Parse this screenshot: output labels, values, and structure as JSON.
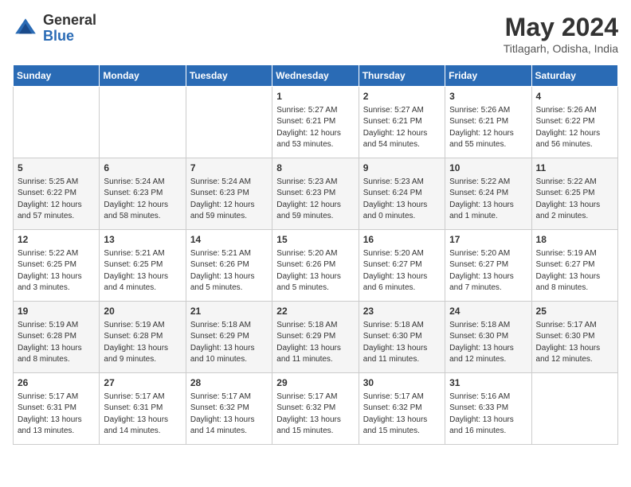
{
  "logo": {
    "general": "General",
    "blue": "Blue"
  },
  "title": {
    "main": "May 2024",
    "sub": "Titlagarh, Odisha, India"
  },
  "weekdays": [
    "Sunday",
    "Monday",
    "Tuesday",
    "Wednesday",
    "Thursday",
    "Friday",
    "Saturday"
  ],
  "weeks": [
    [
      {
        "day": "",
        "content": ""
      },
      {
        "day": "",
        "content": ""
      },
      {
        "day": "",
        "content": ""
      },
      {
        "day": "1",
        "content": "Sunrise: 5:27 AM\nSunset: 6:21 PM\nDaylight: 12 hours\nand 53 minutes."
      },
      {
        "day": "2",
        "content": "Sunrise: 5:27 AM\nSunset: 6:21 PM\nDaylight: 12 hours\nand 54 minutes."
      },
      {
        "day": "3",
        "content": "Sunrise: 5:26 AM\nSunset: 6:21 PM\nDaylight: 12 hours\nand 55 minutes."
      },
      {
        "day": "4",
        "content": "Sunrise: 5:26 AM\nSunset: 6:22 PM\nDaylight: 12 hours\nand 56 minutes."
      }
    ],
    [
      {
        "day": "5",
        "content": "Sunrise: 5:25 AM\nSunset: 6:22 PM\nDaylight: 12 hours\nand 57 minutes."
      },
      {
        "day": "6",
        "content": "Sunrise: 5:24 AM\nSunset: 6:23 PM\nDaylight: 12 hours\nand 58 minutes."
      },
      {
        "day": "7",
        "content": "Sunrise: 5:24 AM\nSunset: 6:23 PM\nDaylight: 12 hours\nand 59 minutes."
      },
      {
        "day": "8",
        "content": "Sunrise: 5:23 AM\nSunset: 6:23 PM\nDaylight: 12 hours\nand 59 minutes."
      },
      {
        "day": "9",
        "content": "Sunrise: 5:23 AM\nSunset: 6:24 PM\nDaylight: 13 hours\nand 0 minutes."
      },
      {
        "day": "10",
        "content": "Sunrise: 5:22 AM\nSunset: 6:24 PM\nDaylight: 13 hours\nand 1 minute."
      },
      {
        "day": "11",
        "content": "Sunrise: 5:22 AM\nSunset: 6:25 PM\nDaylight: 13 hours\nand 2 minutes."
      }
    ],
    [
      {
        "day": "12",
        "content": "Sunrise: 5:22 AM\nSunset: 6:25 PM\nDaylight: 13 hours\nand 3 minutes."
      },
      {
        "day": "13",
        "content": "Sunrise: 5:21 AM\nSunset: 6:25 PM\nDaylight: 13 hours\nand 4 minutes."
      },
      {
        "day": "14",
        "content": "Sunrise: 5:21 AM\nSunset: 6:26 PM\nDaylight: 13 hours\nand 5 minutes."
      },
      {
        "day": "15",
        "content": "Sunrise: 5:20 AM\nSunset: 6:26 PM\nDaylight: 13 hours\nand 5 minutes."
      },
      {
        "day": "16",
        "content": "Sunrise: 5:20 AM\nSunset: 6:27 PM\nDaylight: 13 hours\nand 6 minutes."
      },
      {
        "day": "17",
        "content": "Sunrise: 5:20 AM\nSunset: 6:27 PM\nDaylight: 13 hours\nand 7 minutes."
      },
      {
        "day": "18",
        "content": "Sunrise: 5:19 AM\nSunset: 6:27 PM\nDaylight: 13 hours\nand 8 minutes."
      }
    ],
    [
      {
        "day": "19",
        "content": "Sunrise: 5:19 AM\nSunset: 6:28 PM\nDaylight: 13 hours\nand 8 minutes."
      },
      {
        "day": "20",
        "content": "Sunrise: 5:19 AM\nSunset: 6:28 PM\nDaylight: 13 hours\nand 9 minutes."
      },
      {
        "day": "21",
        "content": "Sunrise: 5:18 AM\nSunset: 6:29 PM\nDaylight: 13 hours\nand 10 minutes."
      },
      {
        "day": "22",
        "content": "Sunrise: 5:18 AM\nSunset: 6:29 PM\nDaylight: 13 hours\nand 11 minutes."
      },
      {
        "day": "23",
        "content": "Sunrise: 5:18 AM\nSunset: 6:30 PM\nDaylight: 13 hours\nand 11 minutes."
      },
      {
        "day": "24",
        "content": "Sunrise: 5:18 AM\nSunset: 6:30 PM\nDaylight: 13 hours\nand 12 minutes."
      },
      {
        "day": "25",
        "content": "Sunrise: 5:17 AM\nSunset: 6:30 PM\nDaylight: 13 hours\nand 12 minutes."
      }
    ],
    [
      {
        "day": "26",
        "content": "Sunrise: 5:17 AM\nSunset: 6:31 PM\nDaylight: 13 hours\nand 13 minutes."
      },
      {
        "day": "27",
        "content": "Sunrise: 5:17 AM\nSunset: 6:31 PM\nDaylight: 13 hours\nand 14 minutes."
      },
      {
        "day": "28",
        "content": "Sunrise: 5:17 AM\nSunset: 6:32 PM\nDaylight: 13 hours\nand 14 minutes."
      },
      {
        "day": "29",
        "content": "Sunrise: 5:17 AM\nSunset: 6:32 PM\nDaylight: 13 hours\nand 15 minutes."
      },
      {
        "day": "30",
        "content": "Sunrise: 5:17 AM\nSunset: 6:32 PM\nDaylight: 13 hours\nand 15 minutes."
      },
      {
        "day": "31",
        "content": "Sunrise: 5:16 AM\nSunset: 6:33 PM\nDaylight: 13 hours\nand 16 minutes."
      },
      {
        "day": "",
        "content": ""
      }
    ]
  ]
}
